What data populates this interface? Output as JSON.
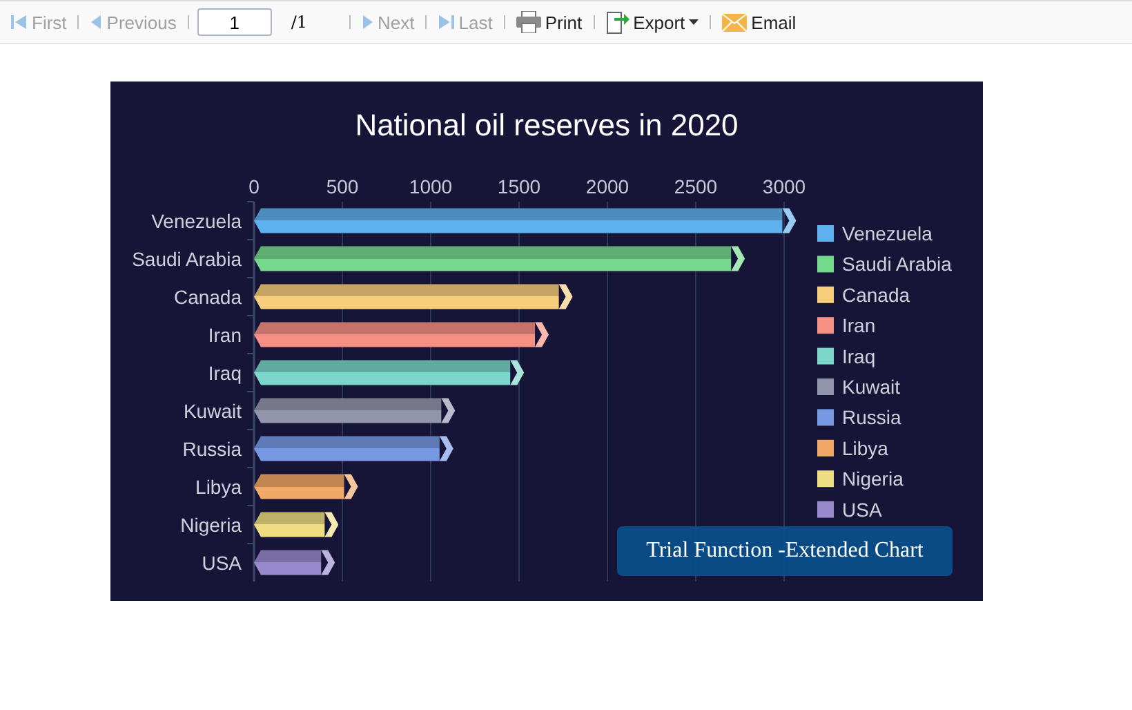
{
  "toolbar": {
    "items": [
      {
        "kind": "first",
        "label": "First",
        "disabled": true
      },
      {
        "kind": "previous",
        "label": "Previous",
        "disabled": true
      },
      {
        "kind": "page",
        "value": "1",
        "total": "/1"
      },
      {
        "kind": "next",
        "label": "Next",
        "disabled": true
      },
      {
        "kind": "last",
        "label": "Last",
        "disabled": true
      },
      {
        "kind": "print",
        "label": "Print",
        "disabled": false
      },
      {
        "kind": "export",
        "label": "Export",
        "disabled": false
      },
      {
        "kind": "email",
        "label": "Email",
        "disabled": false
      }
    ]
  },
  "report": {
    "trial_badge": "Trial Function -Extended Chart",
    "chart_data": {
      "type": "bar",
      "orientation": "horizontal",
      "title": "National oil reserves in 2020",
      "categories": [
        "Venezuela",
        "Saudi Arabia",
        "Canada",
        "Iran",
        "Iraq",
        "Kuwait",
        "Russia",
        "Libya",
        "Nigeria",
        "USA"
      ],
      "xticks": [
        0,
        500,
        1000,
        1500,
        2000,
        2500,
        3000
      ],
      "xlim": [
        0,
        3000
      ],
      "grid": true,
      "values": [
        2990,
        2700,
        1725,
        1590,
        1450,
        1060,
        1050,
        510,
        400,
        380
      ]
    },
    "legend": [
      {
        "name": "Venezuela",
        "color": "#5fb0ee"
      },
      {
        "name": "Saudi Arabia",
        "color": "#75d98d"
      },
      {
        "name": "Canada",
        "color": "#f8cd7c"
      },
      {
        "name": "Iran",
        "color": "#f68f84"
      },
      {
        "name": "Iraq",
        "color": "#7bd6cc"
      },
      {
        "name": "Kuwait",
        "color": "#9395ad"
      },
      {
        "name": "Russia",
        "color": "#7799e3"
      },
      {
        "name": "Libya",
        "color": "#f2a866"
      },
      {
        "name": "Nigeria",
        "color": "#eedd82"
      },
      {
        "name": "USA",
        "color": "#9888cc"
      }
    ]
  }
}
